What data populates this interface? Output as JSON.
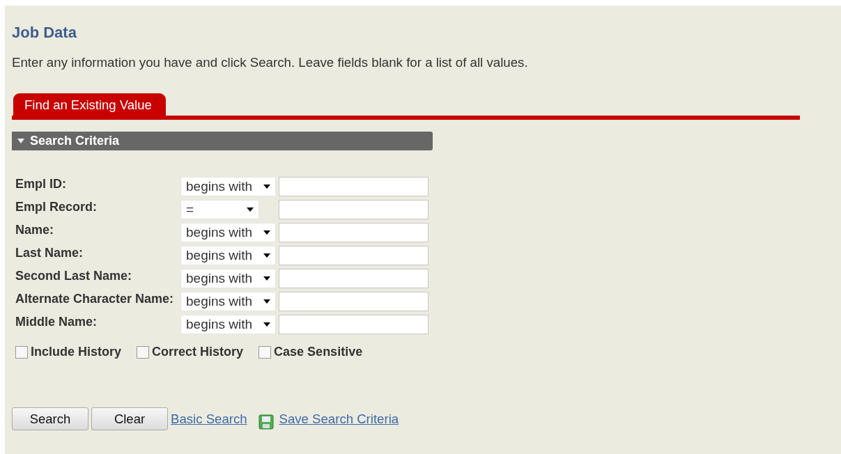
{
  "page": {
    "title": "Job Data",
    "instructions": "Enter any information you have and click Search. Leave fields blank for a list of all values."
  },
  "tabs": [
    {
      "label": "Find an Existing Value",
      "selected": true
    }
  ],
  "section": {
    "title": "Search Criteria",
    "expanded": true
  },
  "fields": [
    {
      "label": "Empl ID:",
      "operator": "begins with",
      "wide": true
    },
    {
      "label": "Empl Record:",
      "operator": "=",
      "wide": false
    },
    {
      "label": "Name:",
      "operator": "begins with",
      "wide": true
    },
    {
      "label": "Last Name:",
      "operator": "begins with",
      "wide": true
    },
    {
      "label": "Second Last Name:",
      "operator": "begins with",
      "wide": true
    },
    {
      "label": "Alternate Character Name:",
      "operator": "begins with",
      "wide": true
    },
    {
      "label": "Middle Name:",
      "operator": "begins with",
      "wide": true
    }
  ],
  "options": [
    {
      "label": "Include History",
      "checked": false
    },
    {
      "label": "Correct History",
      "checked": false
    },
    {
      "label": "Case Sensitive",
      "checked": false
    }
  ],
  "buttons": [
    {
      "label": "Search"
    },
    {
      "label": "Clear"
    }
  ],
  "links": [
    {
      "label": "Basic Search",
      "kind": "plain"
    },
    {
      "label": "Save Search Criteria",
      "kind": "save"
    }
  ]
}
